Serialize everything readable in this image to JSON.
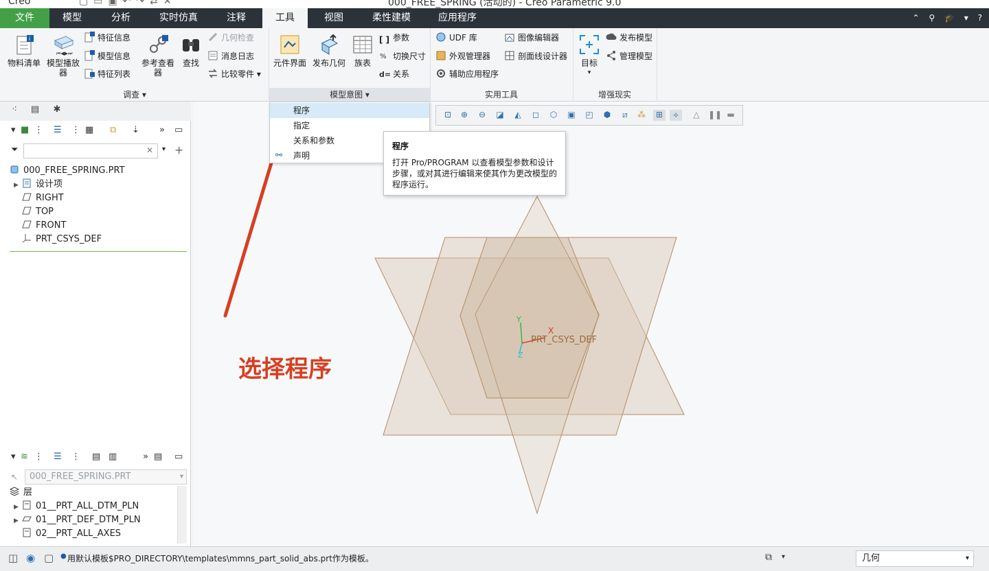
{
  "window": {
    "app_name": "Creo",
    "title": "000_FREE_SPRING (活动的) - Creo Parametric 9.0"
  },
  "tabs": [
    {
      "label": "文件"
    },
    {
      "label": "模型"
    },
    {
      "label": "分析"
    },
    {
      "label": "实时仿真"
    },
    {
      "label": "注释"
    },
    {
      "label": "工具"
    },
    {
      "label": "视图"
    },
    {
      "label": "柔性建模"
    },
    {
      "label": "应用程序"
    }
  ],
  "ribbon": {
    "investigate": {
      "bom": "物料清单",
      "model_player": "模型播放器",
      "feature_info": "特征信息",
      "model_info": "模型信息",
      "feature_list": "特征列表",
      "reference_viewer": "参考查看器",
      "find": "查找",
      "geometry_check": "几何检查",
      "message_log": "消息日志",
      "compare_part": "比较零件",
      "group_label": "调查"
    },
    "model_intent": {
      "component_interface": "元件界面",
      "publish_geometry": "发布几何",
      "family_table": "族表",
      "parameters": "参数",
      "switch_dimensions": "切换尺寸",
      "relations": "关系",
      "group_label": "模型意图"
    },
    "utilities": {
      "udf_library": "UDF 库",
      "appearance_manager": "外观管理器",
      "auxiliary_apps": "辅助应用程序",
      "image_editor": "图像编辑器",
      "xsection_designer": "剖面线设计器",
      "group_label": "实用工具"
    },
    "ar": {
      "target": "目标",
      "publish_model": "发布模型",
      "manage_model": "管理模型",
      "group_label": "增强现实"
    }
  },
  "dropdown": {
    "items": [
      {
        "label": "程序"
      },
      {
        "label": "指定"
      },
      {
        "label": "关系和参数"
      },
      {
        "label": "声明"
      }
    ]
  },
  "tooltip": {
    "title": "程序",
    "body": "打开 Pro/PROGRAM 以查看模型参数和设计步骤，或对其进行编辑来使其作为更改模型的程序运行。"
  },
  "model_tree": {
    "items": [
      {
        "label": "000_FREE_SPRING.PRT"
      },
      {
        "label": "设计项"
      },
      {
        "label": "RIGHT"
      },
      {
        "label": "TOP"
      },
      {
        "label": "FRONT"
      },
      {
        "label": "PRT_CSYS_DEF"
      }
    ]
  },
  "layer_tree": {
    "selector": "000_FREE_SPRING.PRT",
    "items": [
      {
        "label": "层"
      },
      {
        "label": "01__PRT_ALL_DTM_PLN"
      },
      {
        "label": "01__PRT_DEF_DTM_PLN"
      },
      {
        "label": "02__PRT_ALL_AXES"
      }
    ]
  },
  "graphics": {
    "csys_label": "PRT_CSYS_DEF",
    "axis_x": "X",
    "axis_y": "Y",
    "axis_z": "Z"
  },
  "annotation": "选择程序",
  "status": {
    "message": "用默认模板$PRO_DIRECTORY\\templates\\mmns_part_solid_abs.prt作为模板。",
    "filter_value": "几何"
  },
  "colors": {
    "file_tab": "#43a047",
    "tab_bar": "#2c3239",
    "annotation": "#d63f22",
    "plane_fill": "#d8c8b4",
    "plane_stroke": "#b48a64",
    "highlight": "#d6ebf7"
  }
}
